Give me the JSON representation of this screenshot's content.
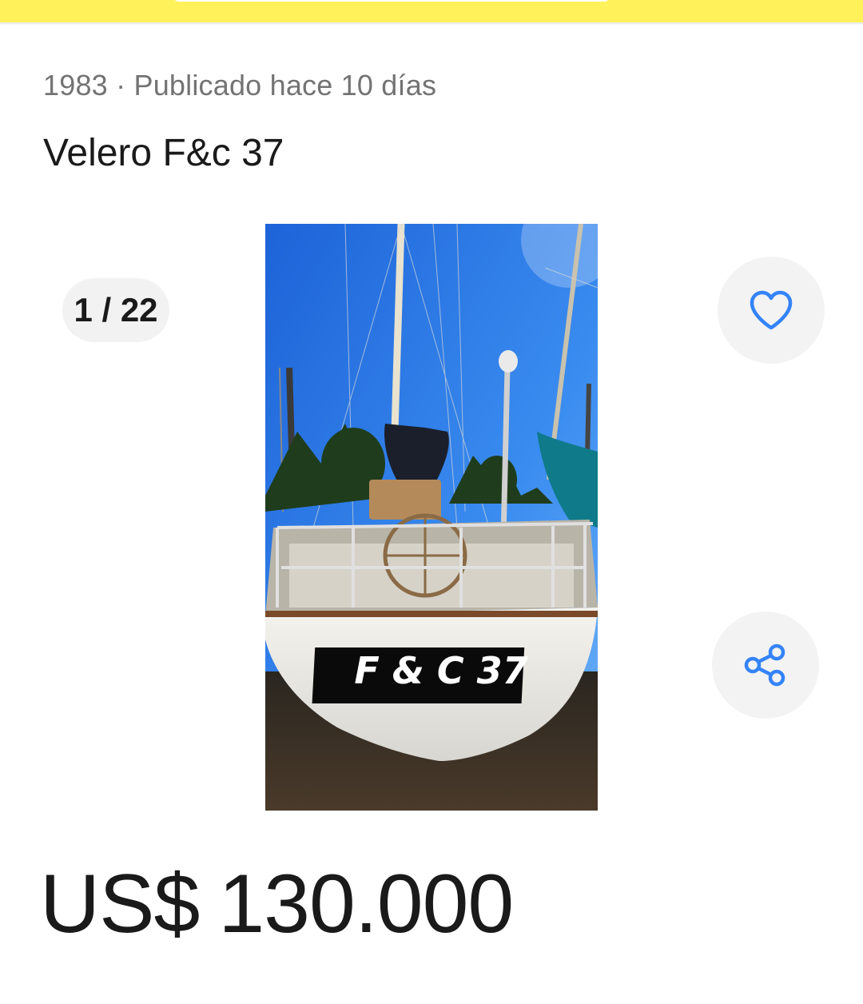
{
  "header": {
    "accent_color": "#fff159"
  },
  "listing": {
    "subtitle": "1983 · Publicado hace 10 días",
    "title": "Velero F&c 37",
    "gallery": {
      "counter": "1 / 22",
      "image_label": "F & C  37"
    },
    "price": {
      "currency": "US$",
      "amount": "130.000"
    }
  },
  "actions": {
    "favorite_icon": "heart-outline-icon",
    "share_icon": "share-icon",
    "icon_color": "#3483fa"
  }
}
